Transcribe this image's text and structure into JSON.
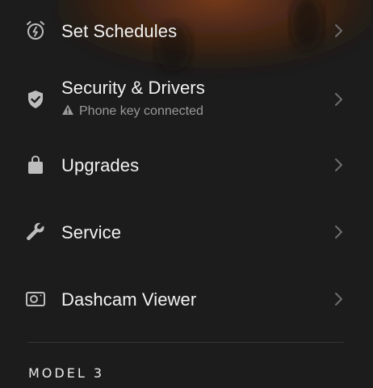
{
  "menu": {
    "items": [
      {
        "label": "Set Schedules",
        "icon": "alarm-bolt-icon"
      },
      {
        "label": "Security & Drivers",
        "icon": "shield-check-icon",
        "sublabel": "Phone key connected",
        "sublabel_icon": "warning-icon"
      },
      {
        "label": "Upgrades",
        "icon": "shopping-bag-icon"
      },
      {
        "label": "Service",
        "icon": "wrench-icon"
      },
      {
        "label": "Dashcam Viewer",
        "icon": "dashcam-icon"
      }
    ]
  },
  "footer": {
    "model_name": "MODEL 3"
  },
  "colors": {
    "background": "#1c1c1c",
    "text": "#f2f2f2",
    "subtext": "#9a9a9a",
    "icon": "#bdbdbd",
    "divider": "#353535"
  }
}
